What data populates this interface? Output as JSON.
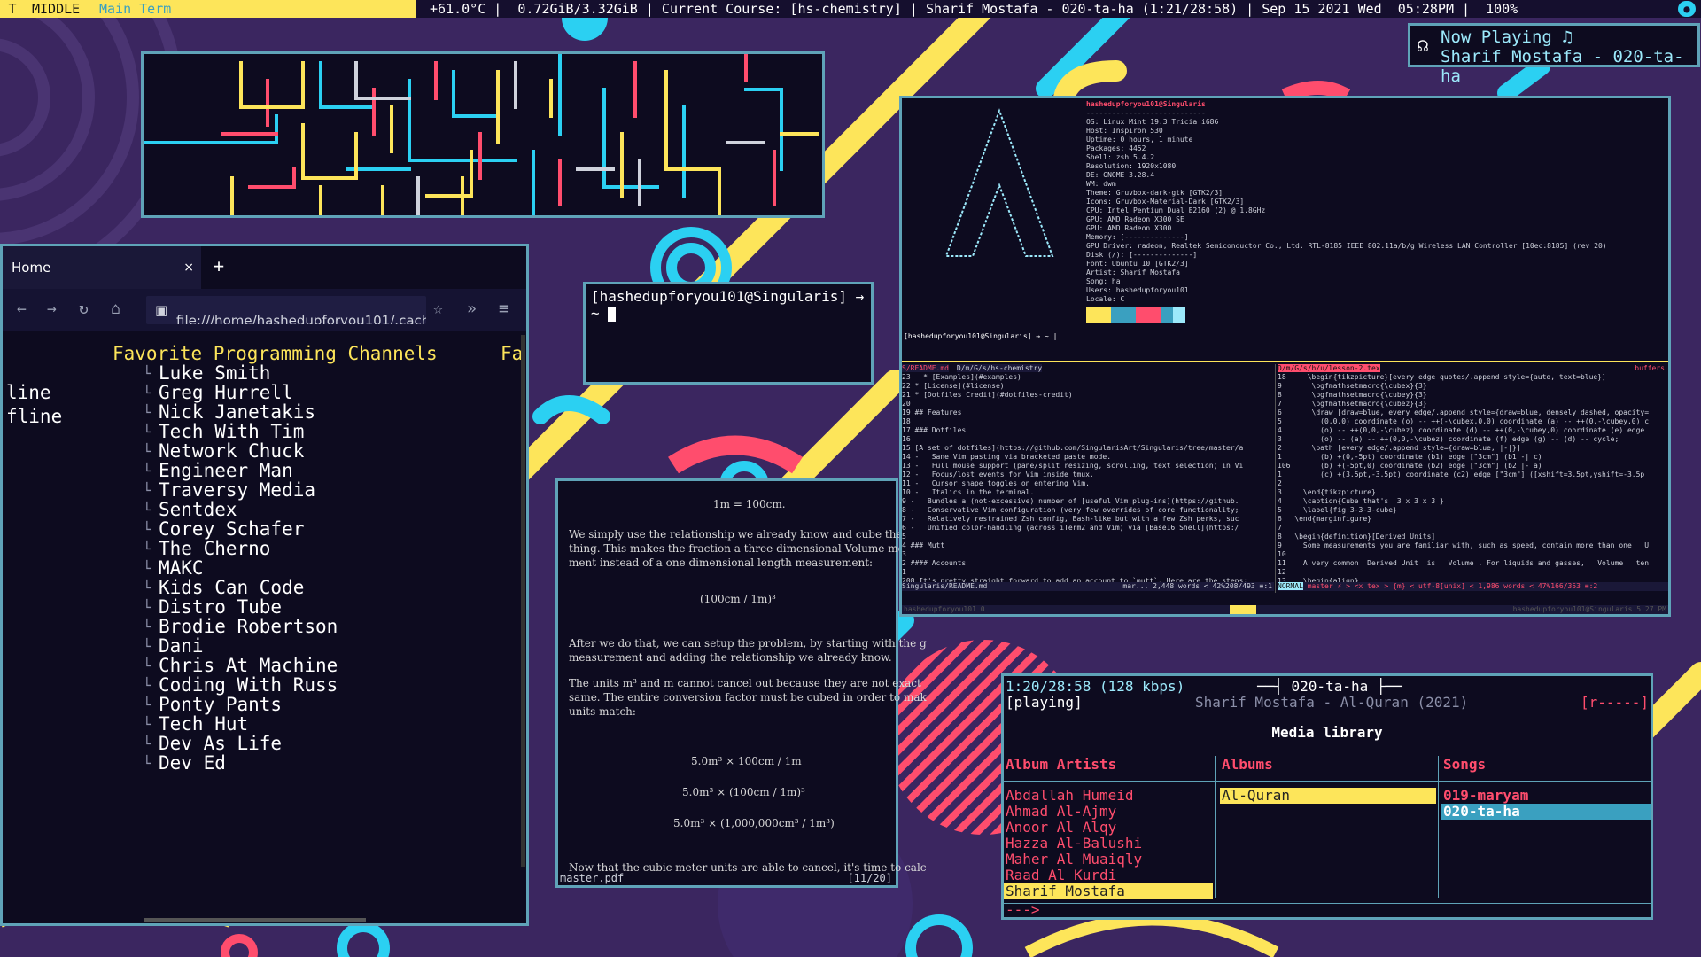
{
  "topbar": {
    "workspace_icon": "T",
    "workspace_mode": "MIDDLE",
    "workspace_title": "Main Term",
    "status": " +61.0°C |  0.72GiB/3.32GiB | Current Course: [hs-chemistry] | Sharif Mostafa - 020-ta-ha (1:21/28:58) | Sep 15 2021 Wed  05:28PM |  100%  ",
    "tray_icon": "●"
  },
  "now_playing": {
    "heading": "Now Playing ♫",
    "track": "Sharif Mostafa - 020-ta-ha",
    "icon": "headphones-icon"
  },
  "browser": {
    "tab_title": "Home",
    "tab_close": "×",
    "new_tab": "+",
    "url": "file:///home/hashedupforyou101/.cache",
    "heading": "Favorite Programming Channels",
    "left_fragment_1": "line",
    "left_fragment_2": "fline",
    "right_fragment": "Fa",
    "channels": [
      "Luke Smith",
      "Greg Hurrell",
      "Nick Janetakis",
      "Tech With Tim",
      "Network Chuck",
      "Engineer Man",
      "Traversy Media",
      "Sentdex",
      "Corey Schafer",
      "The Cherno",
      "MAKC",
      "Kids Can Code",
      "Distro Tube",
      "Brodie Robertson",
      "Dani",
      "Chris At Machine",
      "Coding With Russ",
      "Ponty Pants",
      "Tech Hut",
      "Dev As Life",
      "Dev Ed"
    ]
  },
  "terminal": {
    "prompt": "[hashedupforyou101@Singularis] → ~ "
  },
  "pdf": {
    "eq1": "1m = 100cm.",
    "p1a": "We simply use the relationship we already know and cube the e",
    "p1b": "thing. This makes the fraction a three dimensional Volume mea",
    "p1c": "ment instead of a one dimensional length measurement:",
    "eq2": "(100cm / 1m)³",
    "p2a": "After we do that, we can setup the problem, by starting with the g",
    "p2b": "measurement and adding the relationship we already know.",
    "p3a": "The units m³ and m cannot cancel out because they are not exact",
    "p3b": "same. The entire conversion factor must be cubed in order to mak",
    "p3c": "units match:",
    "eq3": "5.0m³ × 100cm / 1m",
    "eq4": "5.0m³ × (100cm / 1m)³",
    "eq5": "5.0m³ × (1,000,000cm³ / 1m³)",
    "p4": "Now that the cubic meter units are able to cancel, it's time to calc",
    "filename": "master.pdf",
    "page": "[11/20]"
  },
  "neofetch": {
    "user": "hashedupforyou101@Singularis",
    "sep": "----------------------------",
    "lines": [
      "OS: Linux Mint 19.3 Tricia i686",
      "Host: Inspiron 530",
      "Uptime: 0 hours, 1 minute",
      "Packages: 4452",
      "Shell: zsh 5.4.2",
      "Resolution: 1920x1080",
      "DE: GNOME 3.28.4",
      "WM: dwm",
      "Theme: Gruvbox-dark-gtk [GTK2/3]",
      "Icons: Gruvbox-Material-Dark [GTK2/3]",
      "CPU: Intel Pentium Dual E2160 (2) @ 1.8GHz",
      "GPU: AMD Radeon X300 SE",
      "GPU: AMD Radeon X300",
      "Memory: [--------------]",
      "GPU Driver: radeon, Realtek Semiconductor Co., Ltd. RTL-8185 IEEE 802.11a/b/g Wireless LAN Controller [10ec:8185] (rev 20)",
      "Disk (/): [--------------]",
      "Font: Ubuntu 10 [GTK2/3]",
      "Artist: Sharif Mostafa",
      "Song: ha",
      "Users: hashedupforyou101",
      "Locale: C"
    ],
    "prompt": "[hashedupforyou101@Singularis] → ~ |",
    "palette": [
      "#fde55a",
      "#fde55a",
      "#3aa0c0",
      "#3aa0c0",
      "#ff4d6d",
      "#ff4d6d",
      "#3aa0c0",
      "#9ce9fb"
    ]
  },
  "vim_left": {
    "tab": "S/README.md",
    "path": "D/m/G/s/hs-chemistry",
    "lines": [
      "23   * [Examples](#examples)",
      "22 * [License](#license)",
      "21 * [Dotfiles Credit](#dotfiles-credit)",
      "20",
      "19 ## Features",
      "18",
      "17 ### Dotfiles",
      "16",
      "15 [A set of dotfiles](https://github.com/SingularisArt/Singularis/tree/master/a",
      "14 -   Sane Vim pasting via bracketed paste mode.",
      "13 -   Full mouse support (pane/split resizing, scrolling, text selection) in Vi",
      "12 -   Focus/lost events for Vim inside tmux.",
      "11 -   Cursor shape toggles on entering Vim.",
      "10 -   Italics in the terminal.",
      "9 -   Bundles a (not-excessive) number of [useful Vim plug-ins](https://github.",
      "8 -   Conservative Vim configuration (very few overrides of core functionality;",
      "7 -   Relatively restrained Zsh config, Bash-like but with a few Zsh perks, suc",
      "6 -   Unified color-handling (across iTerm2 and Vim) via [Base16 Shell](https:/",
      "5",
      "4 ### Mutt",
      "3",
      "2 #### Accounts",
      "1",
      "208 It's pretty straight forward to add an account to `mutt`. Here are the steps:"
    ],
    "status_file": "Singularis/README.md",
    "status_info": "mar... 2,448 words < 42%208/493 ≡:1"
  },
  "vim_right": {
    "tab": "D/m/G/s/h/u/lesson-2.tex",
    "buffers": "buffers",
    "lines": [
      "18     \\begin{tikzpicture}[every edge quotes/.append style={auto, text=blue}]",
      "9       \\pgfmathsetmacro{\\cubex}{3}",
      "8       \\pgfmathsetmacro{\\cubey}{3}",
      "7       \\pgfmathsetmacro{\\cubez}{3}",
      "6       \\draw [draw=blue, every edge/.append style={draw=blue, densely dashed, opacity=",
      "5         (0,0,0) coordinate (o) -- ++(-\\cubex,0,0) coordinate (a) -- ++(0,-\\cubey,0) c",
      "4         (o) -- ++(0,0,-\\cubez) coordinate (d) -- ++(0,-\\cubey,0) coordinate (e) edge",
      "3         (o) -- (a) -- ++(0,0,-\\cubez) coordinate (f) edge (g) -- (d) -- cycle;",
      "2       \\path [every edge/.append style={draw=blue, |-|}]",
      "1         (b) +(0,-5pt) coordinate (b1) edge [\"3cm\"] (b1 -| c)",
      "106       (b) +(-5pt,0) coordinate (b2) edge [\"3cm\"] (b2 |- a)",
      "1         (c) +(3.5pt,-3.5pt) coordinate (c2) edge [\"3cm\"] ([xshift=3.5pt,yshift=-3.5p",
      "2",
      "3     \\end{tikzpicture}",
      "4     \\caption{Cube that's  3 x 3 x 3 }",
      "5     \\label{fig:3-3-3-cube}",
      "6   \\end{marginfigure}",
      "7",
      "8   \\begin{definition}[Derived Units]",
      "9     Some measurements you are familiar with, such as speed, contain more than one   U",
      "10",
      "11    A very common  Derived Unit  is   Volume . For liquids and gasses,   Volume   ten",
      "12",
      "13    \\begin{align}"
    ],
    "status_mode": "NORMAL",
    "status_info": "master ⚡ > <x  tex > {m} < utf-8[unix] < 1,986 words < 47%166/353 ≡:2"
  },
  "tmux": {
    "left": "hashedupforyou101 0",
    "right": "hashedupforyou101@Singularis  5:27 PM"
  },
  "cmus": {
    "time": "1:20/28:58 (128 kbps)",
    "title": "020-ta-ha",
    "state": "[playing]",
    "now": "Sharif Mostafa - Al-Quran (2021)",
    "flags": "[r-----]",
    "library_title": "Media library",
    "col_artists": "Album Artists",
    "col_albums": "Albums",
    "col_songs": "Songs",
    "artists": [
      "Abdallah Humeid",
      "Ahmad Al-Ajmy",
      "Anoor Al Alqy",
      "Hazza Al-Balushi",
      "Maher Al Muaiqly",
      "Raad Al Kurdi",
      "Sharif Mostafa"
    ],
    "albums": [
      "Al-Quran"
    ],
    "songs": [
      "019-maryam",
      "020-ta-ha"
    ],
    "cmdline": "--->"
  }
}
